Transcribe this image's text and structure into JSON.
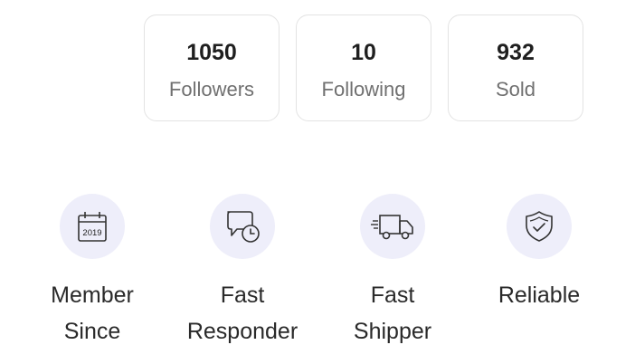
{
  "stats": [
    {
      "value": "1050",
      "label": "Followers"
    },
    {
      "value": "10",
      "label": "Following"
    },
    {
      "value": "932",
      "label": "Sold"
    }
  ],
  "badges": [
    {
      "icon": "calendar-icon",
      "icon_text": "2019",
      "line1": "Member",
      "line2": "Since"
    },
    {
      "icon": "chat-clock-icon",
      "line1": "Fast",
      "line2": "Responder"
    },
    {
      "icon": "truck-icon",
      "line1": "Fast",
      "line2": "Shipper"
    },
    {
      "icon": "shield-check-icon",
      "line1": "Reliable",
      "line2": ""
    }
  ],
  "colors": {
    "badge_bg": "#eeeefa",
    "card_border": "#e3e3e3",
    "label_gray": "#707070"
  }
}
